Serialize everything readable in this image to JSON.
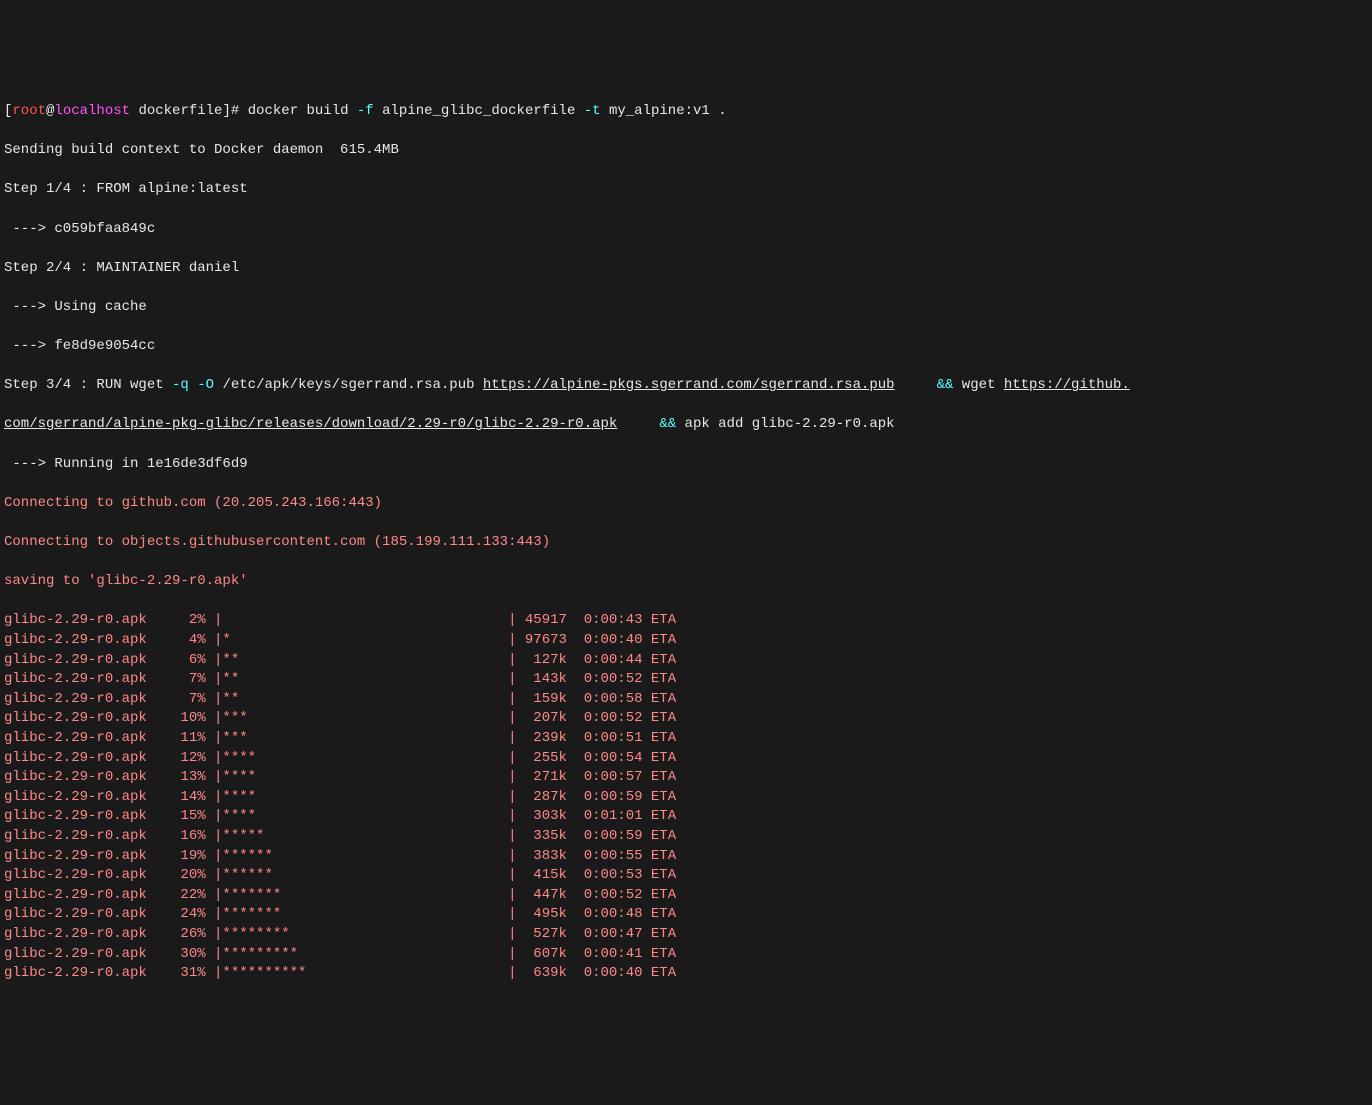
{
  "prompt": {
    "bracket_open": "[",
    "user": "root",
    "at": "@",
    "host": "localhost",
    "dir": " dockerfile",
    "bracket_close": "]# ",
    "cmd_docker": "docker build ",
    "flag_f": "-f",
    "arg_f": " alpine_glibc_dockerfile ",
    "flag_t": "-t",
    "arg_t": " my_alpine:v1 ."
  },
  "l2": "Sending build context to Docker daemon  615.4MB",
  "l3": "Step 1/4 : FROM alpine:latest",
  "l4": " ---> c059bfaa849c",
  "l5": "Step 2/4 : MAINTAINER daniel",
  "l6": " ---> Using cache",
  "l7": " ---> fe8d9e9054cc",
  "step3": {
    "pre": "Step 3/4 : RUN wget ",
    "flag_q": "-q",
    "sp1": " ",
    "flag_O": "-O",
    "path": " /etc/apk/keys/sgerrand.rsa.pub ",
    "url1": "https://alpine-pkgs.sgerrand.com/sgerrand.rsa.pub",
    "gap1": "     ",
    "and1": "&&",
    "wget2": " wget ",
    "url2a": "https://github.",
    "url2b": "com/sgerrand/alpine-pkg-glibc/releases/download/2.29-r0/glibc-2.29-r0.apk",
    "gap2": "     ",
    "and2": "&&",
    "apk": " apk add glibc-2.29-r0.apk"
  },
  "l9": " ---> Running in 1e16de3df6d9",
  "l10": "Connecting to github.com (20.205.243.166:443)",
  "l11": "Connecting to objects.githubusercontent.com (185.199.111.133:443)",
  "l12": "saving to 'glibc-2.29-r0.apk'",
  "progress": [
    {
      "file": "glibc-2.29-r0.apk",
      "pct": "  2%",
      "bar": "|                                  | ",
      "size": "45917 ",
      "eta": " 0:00:43 ETA"
    },
    {
      "file": "glibc-2.29-r0.apk",
      "pct": "  4%",
      "bar": "|*                                 | ",
      "size": "97673 ",
      "eta": " 0:00:40 ETA"
    },
    {
      "file": "glibc-2.29-r0.apk",
      "pct": "  6%",
      "bar": "|**                                |  ",
      "size": "127k ",
      "eta": " 0:00:44 ETA"
    },
    {
      "file": "glibc-2.29-r0.apk",
      "pct": "  7%",
      "bar": "|**                                |  ",
      "size": "143k ",
      "eta": " 0:00:52 ETA"
    },
    {
      "file": "glibc-2.29-r0.apk",
      "pct": "  7%",
      "bar": "|**                                |  ",
      "size": "159k ",
      "eta": " 0:00:58 ETA"
    },
    {
      "file": "glibc-2.29-r0.apk",
      "pct": " 10%",
      "bar": "|***                               |  ",
      "size": "207k ",
      "eta": " 0:00:52 ETA"
    },
    {
      "file": "glibc-2.29-r0.apk",
      "pct": " 11%",
      "bar": "|***                               |  ",
      "size": "239k ",
      "eta": " 0:00:51 ETA"
    },
    {
      "file": "glibc-2.29-r0.apk",
      "pct": " 12%",
      "bar": "|****                              |  ",
      "size": "255k ",
      "eta": " 0:00:54 ETA"
    },
    {
      "file": "glibc-2.29-r0.apk",
      "pct": " 13%",
      "bar": "|****                              |  ",
      "size": "271k ",
      "eta": " 0:00:57 ETA"
    },
    {
      "file": "glibc-2.29-r0.apk",
      "pct": " 14%",
      "bar": "|****                              |  ",
      "size": "287k ",
      "eta": " 0:00:59 ETA"
    },
    {
      "file": "glibc-2.29-r0.apk",
      "pct": " 15%",
      "bar": "|****                              |  ",
      "size": "303k ",
      "eta": " 0:01:01 ETA"
    },
    {
      "file": "glibc-2.29-r0.apk",
      "pct": " 16%",
      "bar": "|*****                             |  ",
      "size": "335k ",
      "eta": " 0:00:59 ETA"
    },
    {
      "file": "glibc-2.29-r0.apk",
      "pct": " 19%",
      "bar": "|******                            |  ",
      "size": "383k ",
      "eta": " 0:00:55 ETA"
    },
    {
      "file": "glibc-2.29-r0.apk",
      "pct": " 20%",
      "bar": "|******                            |  ",
      "size": "415k ",
      "eta": " 0:00:53 ETA"
    },
    {
      "file": "glibc-2.29-r0.apk",
      "pct": " 22%",
      "bar": "|*******                           |  ",
      "size": "447k ",
      "eta": " 0:00:52 ETA"
    },
    {
      "file": "glibc-2.29-r0.apk",
      "pct": " 24%",
      "bar": "|*******                           |  ",
      "size": "495k ",
      "eta": " 0:00:48 ETA"
    },
    {
      "file": "glibc-2.29-r0.apk",
      "pct": " 26%",
      "bar": "|********                          |  ",
      "size": "527k ",
      "eta": " 0:00:47 ETA"
    },
    {
      "file": "glibc-2.29-r0.apk",
      "pct": " 30%",
      "bar": "|*********                         |  ",
      "size": "607k ",
      "eta": " 0:00:41 ETA"
    },
    {
      "file": "glibc-2.29-r0.apk",
      "pct": " 31%",
      "bar": "|**********                        |  ",
      "size": "639k ",
      "eta": " 0:00:40 ETA"
    }
  ]
}
